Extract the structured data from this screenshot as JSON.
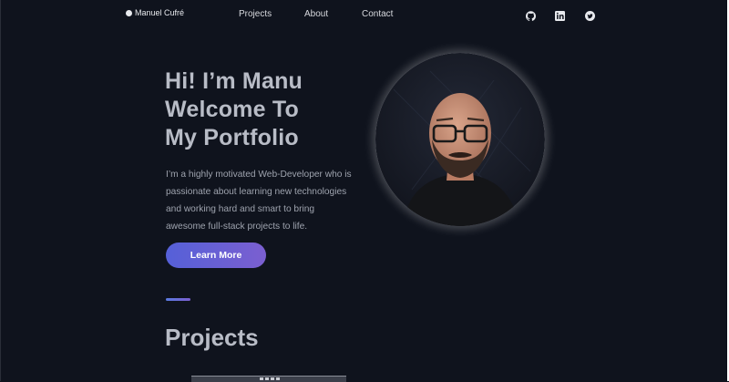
{
  "nav": {
    "brand": "Manuel Cufré",
    "links": [
      "Projects",
      "About",
      "Contact"
    ],
    "social": [
      "github-icon",
      "linkedin-icon",
      "twitter-icon"
    ]
  },
  "hero": {
    "title_lines": [
      "Hi! I’m Manu",
      "Welcome To",
      "My Portfolio"
    ],
    "description_lines": [
      "I’m a highly motivated Web-Developer who is",
      "passionate about learning new technologies",
      "and working hard and smart to bring",
      "awesome full-stack projects to life."
    ],
    "cta_label": "Learn More"
  },
  "projects": {
    "title": "Projects"
  },
  "colors": {
    "background": "#0f131d",
    "accent_start": "#5560d8",
    "accent_end": "#7b5fd0",
    "heading": "#b8bcc6"
  }
}
